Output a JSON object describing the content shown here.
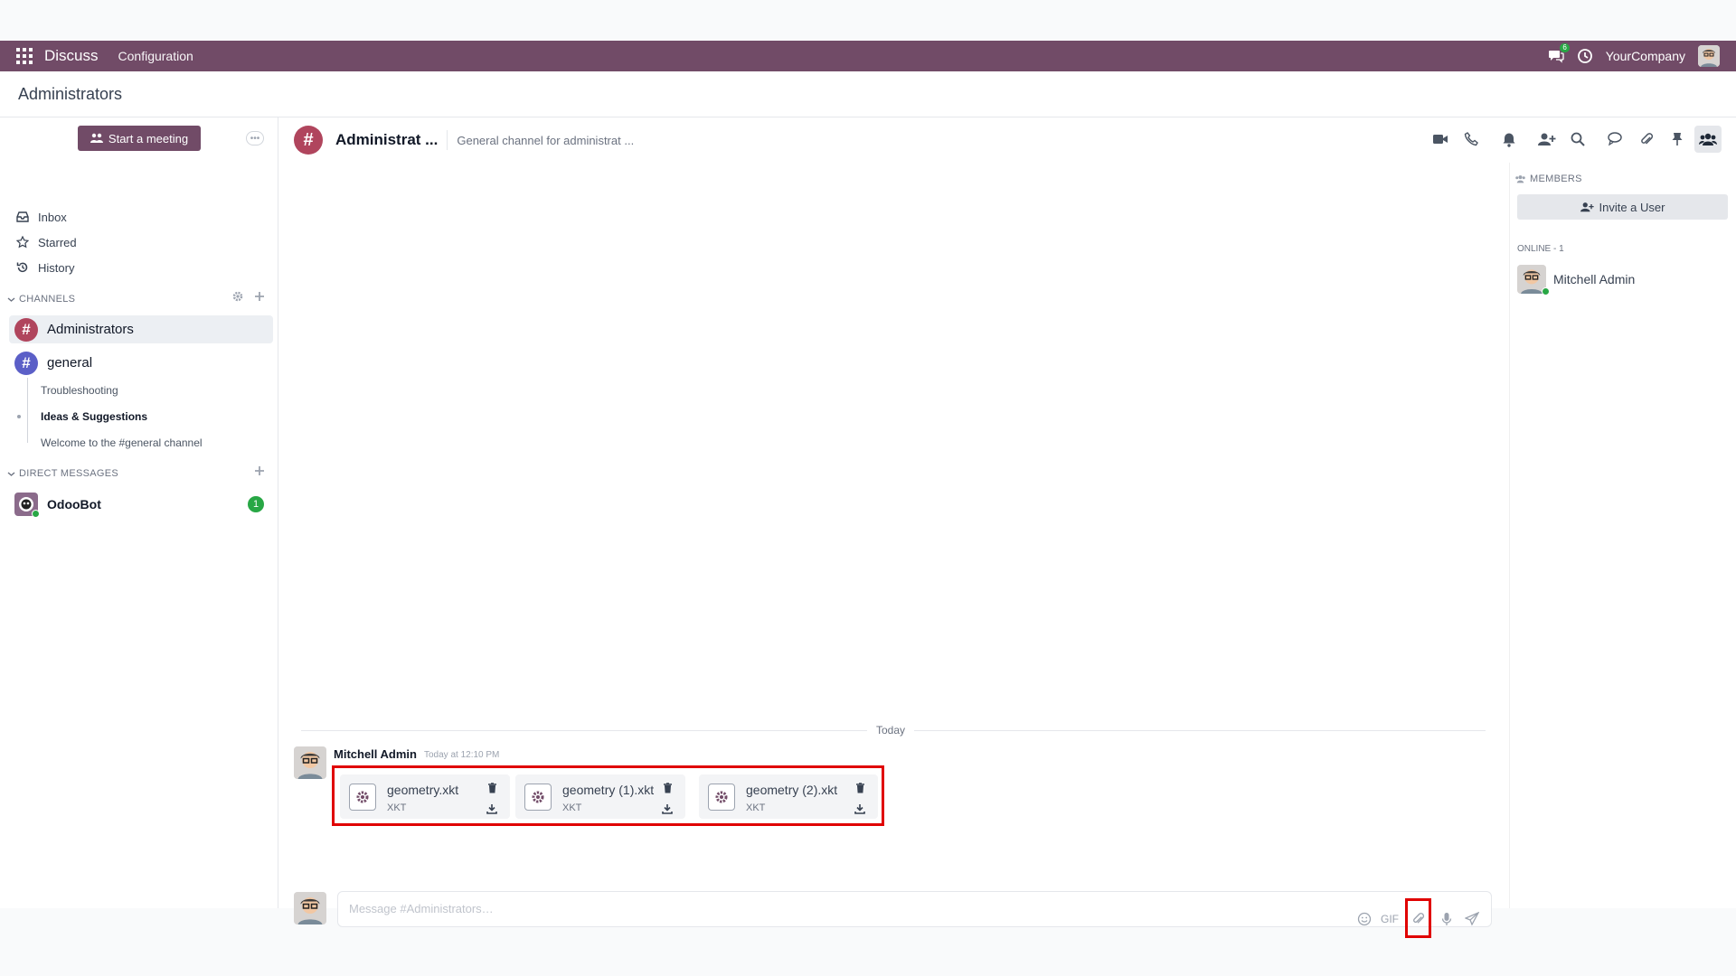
{
  "topnav": {
    "app_name": "Discuss",
    "menu_configuration": "Configuration",
    "messages_badge": "6",
    "company": "YourCompany"
  },
  "breadcrumb": {
    "title": "Administrators"
  },
  "sidebar": {
    "start_meeting": "Start a meeting",
    "more": "•••",
    "nav": [
      {
        "label": "Inbox",
        "icon": "inbox-icon"
      },
      {
        "label": "Starred",
        "icon": "star-icon"
      },
      {
        "label": "History",
        "icon": "history-icon"
      }
    ],
    "channels_header": "CHANNELS",
    "channels": [
      {
        "label": "Administrators",
        "color": "#b0455d"
      },
      {
        "label": "general",
        "color": "#5b5fc7"
      }
    ],
    "threads": [
      {
        "label": "Troubleshooting"
      },
      {
        "label": "Ideas & Suggestions"
      },
      {
        "label": "Welcome to the #general channel"
      }
    ],
    "dm_header": "DIRECT MESSAGES",
    "dms": [
      {
        "label": "OdooBot",
        "count": "1"
      }
    ]
  },
  "thread": {
    "name": "Administrat ...",
    "description": "General channel for administrat ...",
    "today": "Today",
    "message": {
      "author": "Mitchell Admin",
      "time": "Today at 12:10 PM",
      "attachments": [
        {
          "name": "geometry.xkt",
          "ext": "XKT"
        },
        {
          "name": "geometry (1).xkt",
          "ext": "XKT"
        },
        {
          "name": "geometry (2).xkt",
          "ext": "XKT"
        }
      ]
    },
    "composer": {
      "placeholder": "Message #Administrators…",
      "gif": "GIF"
    }
  },
  "members": {
    "header": "MEMBERS",
    "invite": "Invite a User",
    "online_header": "ONLINE - 1",
    "list": [
      {
        "name": "Mitchell Admin"
      }
    ]
  },
  "colors": {
    "brand": "#714B67",
    "highlight": "#e00000",
    "online": "#28a745"
  }
}
